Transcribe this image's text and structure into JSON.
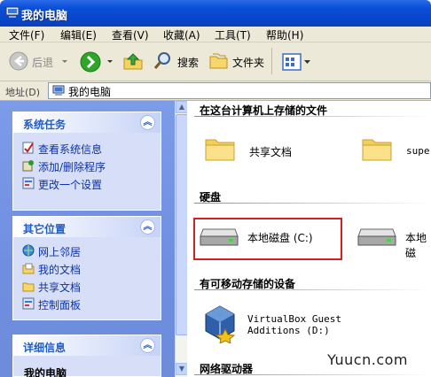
{
  "window": {
    "title": "我的电脑"
  },
  "menu": [
    "文件(F)",
    "编辑(E)",
    "查看(V)",
    "收藏(A)",
    "工具(T)",
    "帮助(H)"
  ],
  "toolbar": {
    "back_label": "后退",
    "search_label": "搜索",
    "folders_label": "文件夹"
  },
  "address": {
    "label": "地址(D)",
    "value": "我的电脑"
  },
  "left_pane": {
    "system_tasks": {
      "title": "系统任务",
      "items": [
        "查看系统信息",
        "添加/删除程序",
        "更改一个设置"
      ]
    },
    "other_places": {
      "title": "其它位置",
      "items": [
        "网上邻居",
        "我的文档",
        "共享文档",
        "控制面板"
      ]
    },
    "details": {
      "title": "详细信息",
      "name": "我的电脑"
    }
  },
  "main": {
    "stored_files": {
      "title": "在这台计算机上存储的文件",
      "items": [
        "共享文档",
        "super"
      ]
    },
    "hard_disks": {
      "title": "硬盘",
      "items": [
        "本地磁盘 (C:)",
        "本地磁"
      ]
    },
    "removable": {
      "title": "有可移动存储的设备",
      "items": [
        "VirtualBox Guest Additions (D:)"
      ]
    },
    "network": {
      "title": "网络驱动器"
    }
  },
  "watermark": "Yuucn.com",
  "colors": {
    "title_bar": "#0846cc",
    "task_pane": "#6f8ee0",
    "link": "#0c32a4",
    "highlight": "#d02020"
  }
}
